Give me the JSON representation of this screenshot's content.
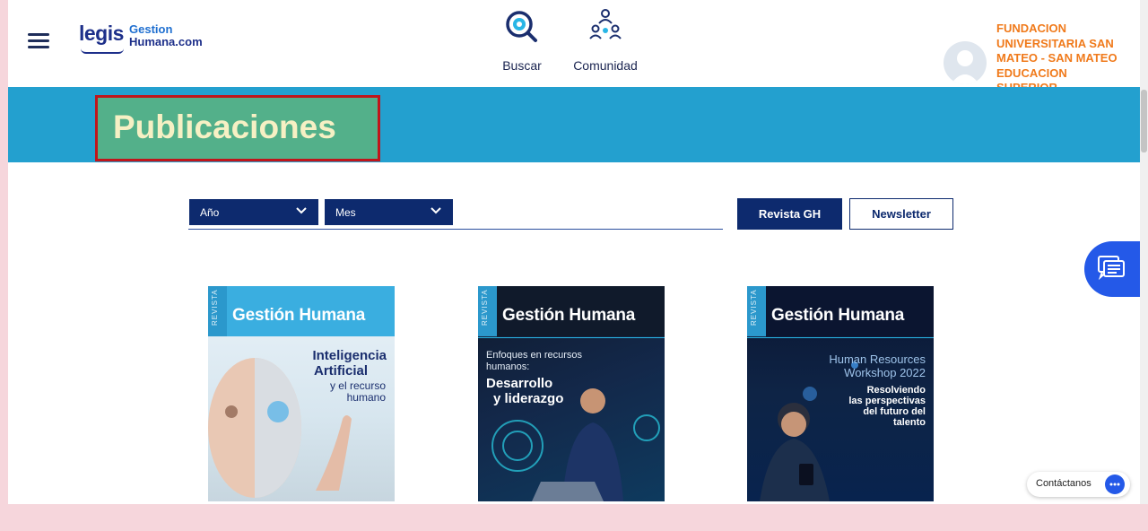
{
  "header": {
    "logo": {
      "brand": "legis",
      "line1": "Gestion",
      "line2": "Humana.com"
    },
    "nav": [
      {
        "label": "Buscar",
        "icon": "search-icon"
      },
      {
        "label": "Comunidad",
        "icon": "community-icon"
      }
    ],
    "user": {
      "avatar_icon": "user-avatar-icon",
      "org_lines": [
        "FUNDACION",
        "UNIVERSITARIA SAN",
        "MATEO - SAN MATEO",
        "EDUCACION",
        "SUPERIOR ."
      ]
    }
  },
  "banner": {
    "title": "Publicaciones"
  },
  "filters": {
    "year": {
      "selected": "Año"
    },
    "month": {
      "selected": "Mes"
    },
    "buttons": {
      "magazine": "Revista GH",
      "newsletter": "Newsletter"
    }
  },
  "publications": [
    {
      "vertical": "REVISTA",
      "title": "Gestión Humana",
      "lines": [
        "Inteligencia",
        "Artificial",
        "y el recurso",
        "humano"
      ]
    },
    {
      "vertical": "REVISTA",
      "title": "Gestión Humana",
      "lines": [
        "Enfoques en recursos",
        "humanos:",
        "Desarrollo",
        "y liderazgo"
      ]
    },
    {
      "vertical": "REVISTA",
      "title": "Gestión Humana",
      "lines": [
        "Human Resources",
        "Workshop 2022",
        "Resolviendo",
        "las perspectivas",
        "del futuro del",
        "talento"
      ]
    }
  ],
  "contact": {
    "label": "Contáctanos"
  },
  "colors": {
    "brand_navy": "#0d2a6e",
    "banner_blue": "#23a0cf",
    "title_bg": "#53b08a",
    "highlight_red": "#c0151b",
    "org_orange": "#f07a1b",
    "chat_blue": "#2459e8"
  }
}
